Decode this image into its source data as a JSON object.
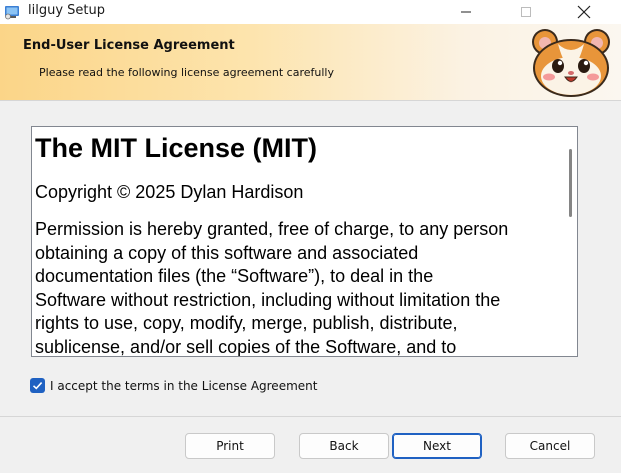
{
  "window": {
    "title": "lilguy Setup"
  },
  "banner": {
    "title": "End-User License Agreement",
    "subtitle": "Please read the following license agreement carefully"
  },
  "license": {
    "heading": "The MIT License (MIT)",
    "copyright": "Copyright © 2025 Dylan Hardison",
    "lines": [
      "Permission is hereby granted, free of charge, to any person",
      "obtaining a copy of this software and associated",
      "documentation files (the “Software”), to deal in the",
      "Software without restriction, including without limitation the",
      "rights to use, copy, modify, merge, publish, distribute,",
      "sublicense, and/or sell copies of the Software, and to"
    ]
  },
  "accept": {
    "label": "I accept the terms in the License Agreement",
    "checked": true
  },
  "buttons": {
    "print": "Print",
    "back": "Back",
    "next": "Next",
    "cancel": "Cancel"
  },
  "colors": {
    "accent": "#1f61c2",
    "banner_start": "#fbd588",
    "banner_end": "#fbf7f0"
  }
}
